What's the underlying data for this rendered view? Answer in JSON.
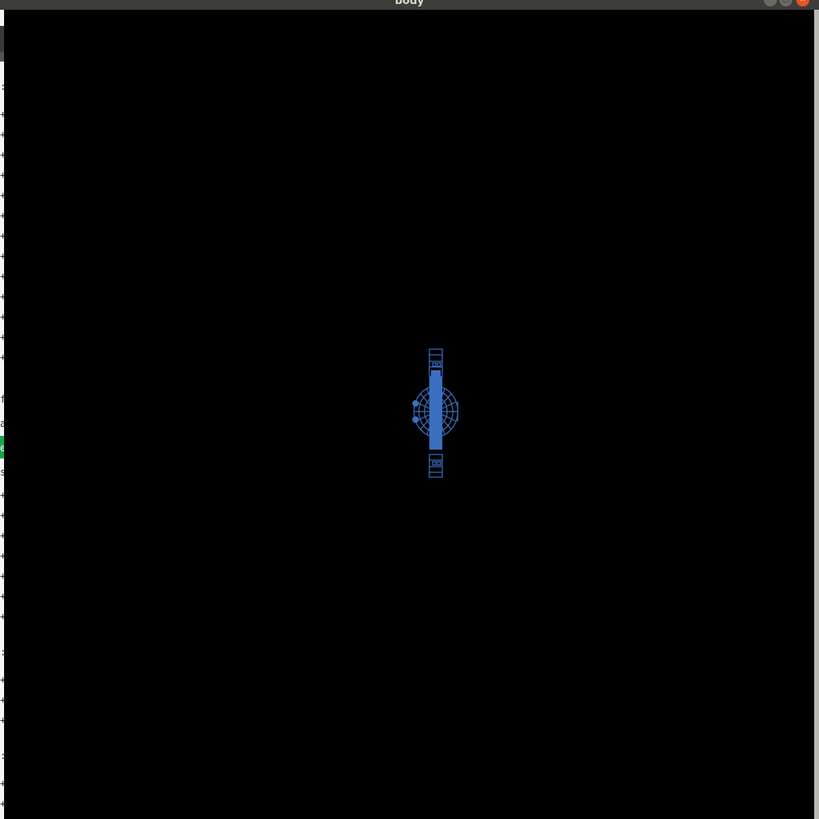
{
  "window": {
    "title": "body",
    "controls": {
      "minimize_icon": "minimize-icon",
      "maximize_icon": "maximize-icon",
      "close_icon": "close-icon"
    }
  },
  "background_app": {
    "visible_fragments": [
      ":",
      "+",
      "+",
      "+",
      "+",
      "+",
      "+",
      "+",
      "+",
      "+",
      "+",
      "+",
      "+",
      "+",
      "f",
      "a",
      "e",
      "s",
      "+",
      "+",
      "+",
      "+",
      "+",
      "+",
      "+",
      ":",
      "+",
      "+",
      "+",
      ":",
      "+",
      "+"
    ]
  },
  "canvas": {
    "background": "#000000",
    "model_color": "#3a6fc0",
    "model_icon": "wireframe-3d-model-icon"
  }
}
